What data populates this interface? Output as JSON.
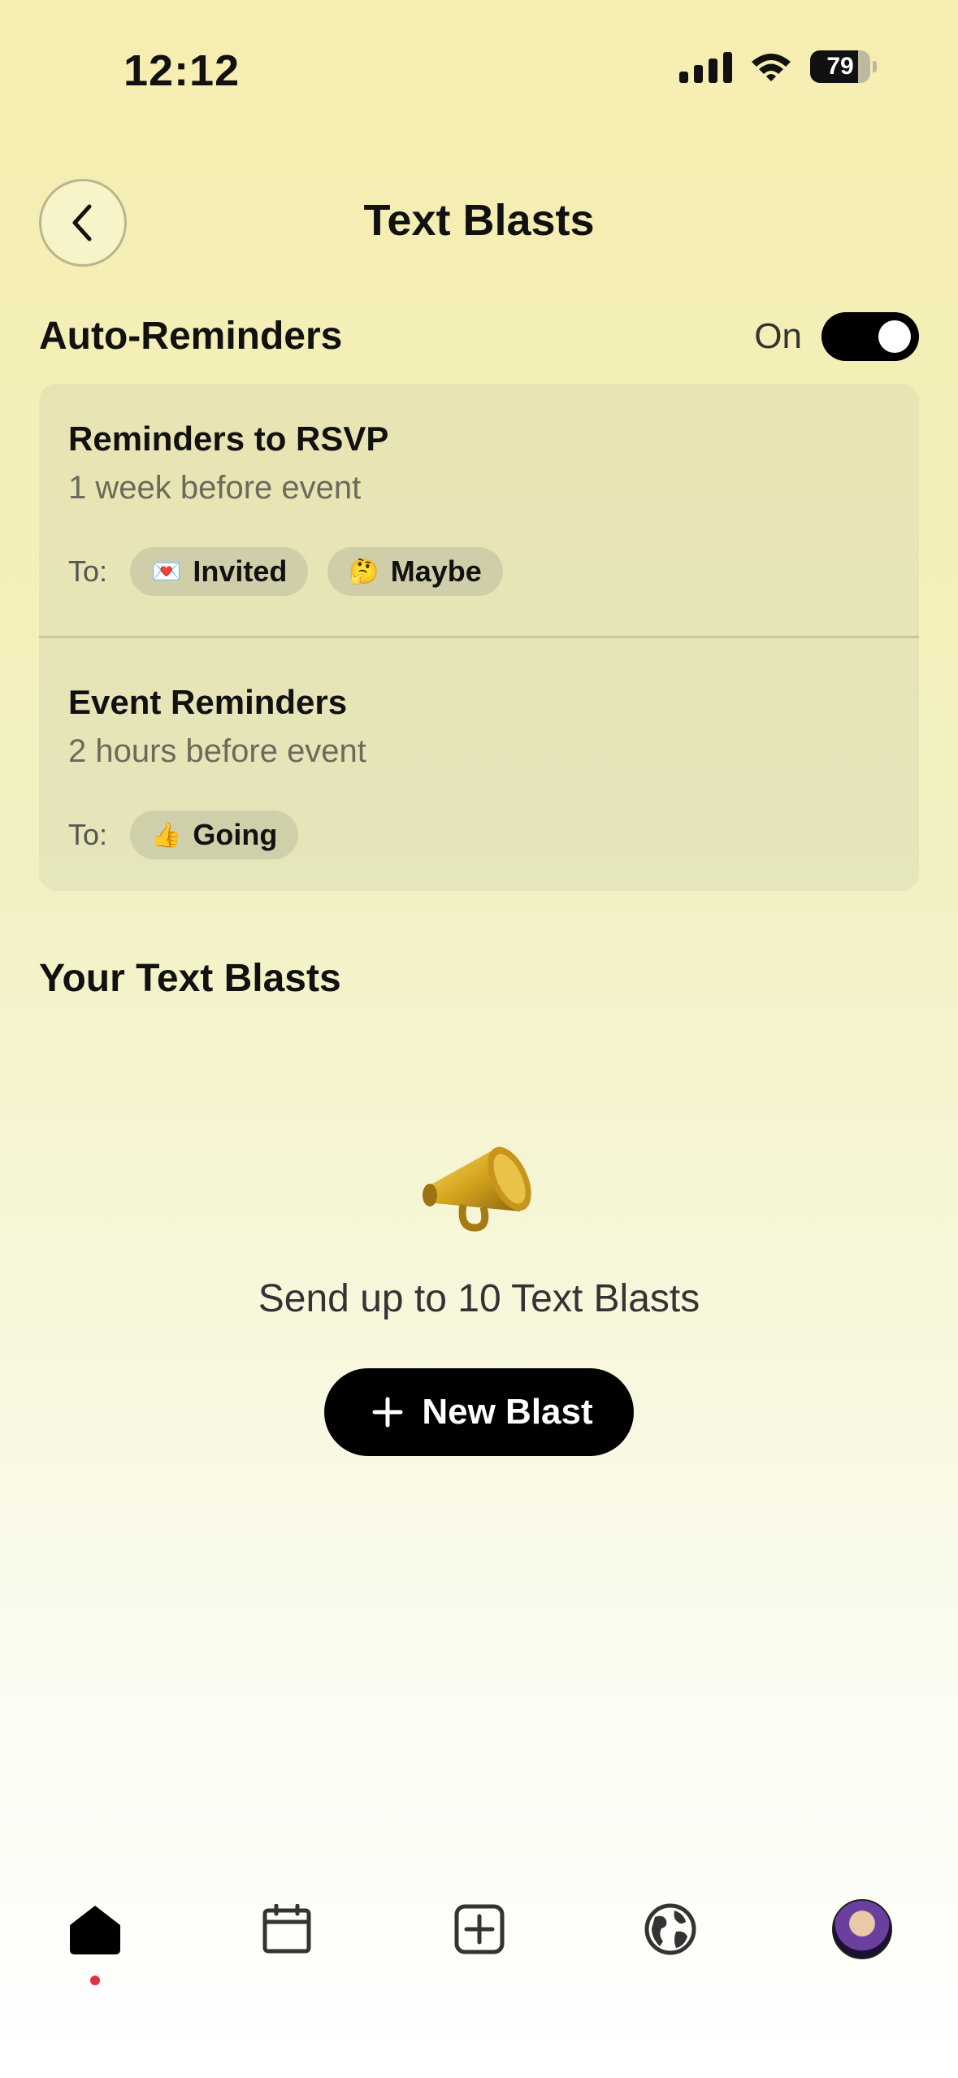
{
  "status_bar": {
    "time": "12:12",
    "battery": "79"
  },
  "header": {
    "title": "Text Blasts"
  },
  "auto_reminders": {
    "title": "Auto-Reminders",
    "toggle_label": "On",
    "items": [
      {
        "title": "Reminders to RSVP",
        "subtitle": "1 week before event",
        "to_label": "To:",
        "chips": [
          {
            "emoji": "💌",
            "label": "Invited"
          },
          {
            "emoji": "🤔",
            "label": "Maybe"
          }
        ]
      },
      {
        "title": "Event Reminders",
        "subtitle": "2 hours before event",
        "to_label": "To:",
        "chips": [
          {
            "emoji": "👍",
            "label": "Going"
          }
        ]
      }
    ]
  },
  "text_blasts": {
    "title": "Your Text Blasts",
    "empty_message": "Send up to 10 Text Blasts",
    "new_button_label": "New Blast"
  },
  "tabbar": {
    "items": [
      {
        "icon": "home-icon",
        "active": true
      },
      {
        "icon": "calendar-icon"
      },
      {
        "icon": "add-square-icon"
      },
      {
        "icon": "globe-icon"
      },
      {
        "icon": "avatar"
      }
    ],
    "active_dot_color": "#e0314b"
  }
}
